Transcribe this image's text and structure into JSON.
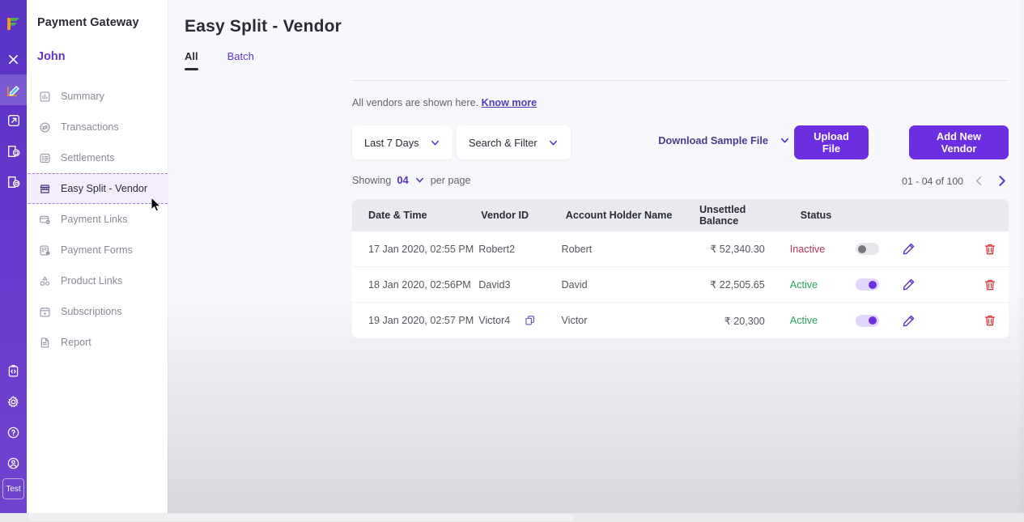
{
  "rail": {
    "logo_name": "app-logo",
    "items": [
      {
        "name": "close-icon",
        "label": "Close"
      },
      {
        "name": "edit-pencil-icon",
        "label": "Edit",
        "selected": true
      },
      {
        "name": "external-link-icon",
        "label": "External Link"
      },
      {
        "name": "refresh-page-icon",
        "label": "Refresh"
      },
      {
        "name": "document-page-icon",
        "label": "Document"
      }
    ],
    "bottom_items": [
      {
        "name": "code-clipboard-icon",
        "label": "Developers"
      },
      {
        "name": "gear-icon",
        "label": "Settings"
      },
      {
        "name": "help-circle-icon",
        "label": "Help"
      },
      {
        "name": "account-circle-icon",
        "label": "Account"
      }
    ],
    "badge_label": "Test"
  },
  "sidebar": {
    "title": "Payment Gateway",
    "user": "John",
    "items": [
      {
        "label": "Summary",
        "icon": "bar-chart-icon"
      },
      {
        "label": "Transactions",
        "icon": "transactions-icon"
      },
      {
        "label": "Settlements",
        "icon": "settlements-icon"
      },
      {
        "label": "Easy Split - Vendor",
        "icon": "storefront-icon"
      },
      {
        "label": "Payment Links",
        "icon": "payment-links-icon"
      },
      {
        "label": "Payment Forms",
        "icon": "payment-forms-icon"
      },
      {
        "label": "Product Links",
        "icon": "product-links-icon"
      },
      {
        "label": "Subscriptions",
        "icon": "calendar-icon"
      },
      {
        "label": "Report",
        "icon": "report-icon"
      }
    ]
  },
  "header": {
    "title": "Easy Split - Vendor",
    "tabs": [
      {
        "label": "All",
        "active": true
      },
      {
        "label": "Batch",
        "active": false
      }
    ],
    "subtext": "All vendors are shown here.",
    "subtext_link": "Know more"
  },
  "toolbar": {
    "date_filter": "Last 7 Days",
    "search_filter": "Search & Filter",
    "download_sample": "Download Sample File",
    "upload_file": "Upload File",
    "add_new_vendor": "Add New Vendor"
  },
  "pagination": {
    "showing_label": "Showing",
    "per_page_value": "04",
    "per_page_label": "per page",
    "range": "01 - 04 of 100",
    "prev_enabled": false,
    "next_enabled": true
  },
  "table": {
    "columns": [
      "Date & Time",
      "Vendor ID",
      "Account Holder Name",
      "Unsettled Balance",
      "Status"
    ],
    "rows": [
      {
        "date": "17 Jan 2020, 02:55 PM",
        "vendor_id": "Robert2",
        "has_copy": false,
        "account_holder": "Robert",
        "balance": "₹ 52,340.30",
        "status": "Inactive",
        "status_state": "inactive",
        "toggle_on": false
      },
      {
        "date": "18 Jan 2020, 02:56PM",
        "vendor_id": "David3",
        "has_copy": false,
        "account_holder": "David",
        "balance": "₹ 22,505.65",
        "status": "Active",
        "status_state": "active",
        "toggle_on": true
      },
      {
        "date": "19 Jan 2020, 02:57 PM",
        "vendor_id": "Victor4",
        "has_copy": true,
        "account_holder": "Victor",
        "balance": "₹ 20,300",
        "status": "Active",
        "status_state": "active",
        "toggle_on": true
      }
    ]
  },
  "colors": {
    "brand_purple": "#6b2ee0",
    "rail_purple": "#6438cc",
    "active_green": "#23a25b",
    "inactive_red": "#b03a52",
    "delete_red": "#e03a3a",
    "header_bg": "#e8eaf0",
    "page_bg": "#f7f8fb"
  }
}
